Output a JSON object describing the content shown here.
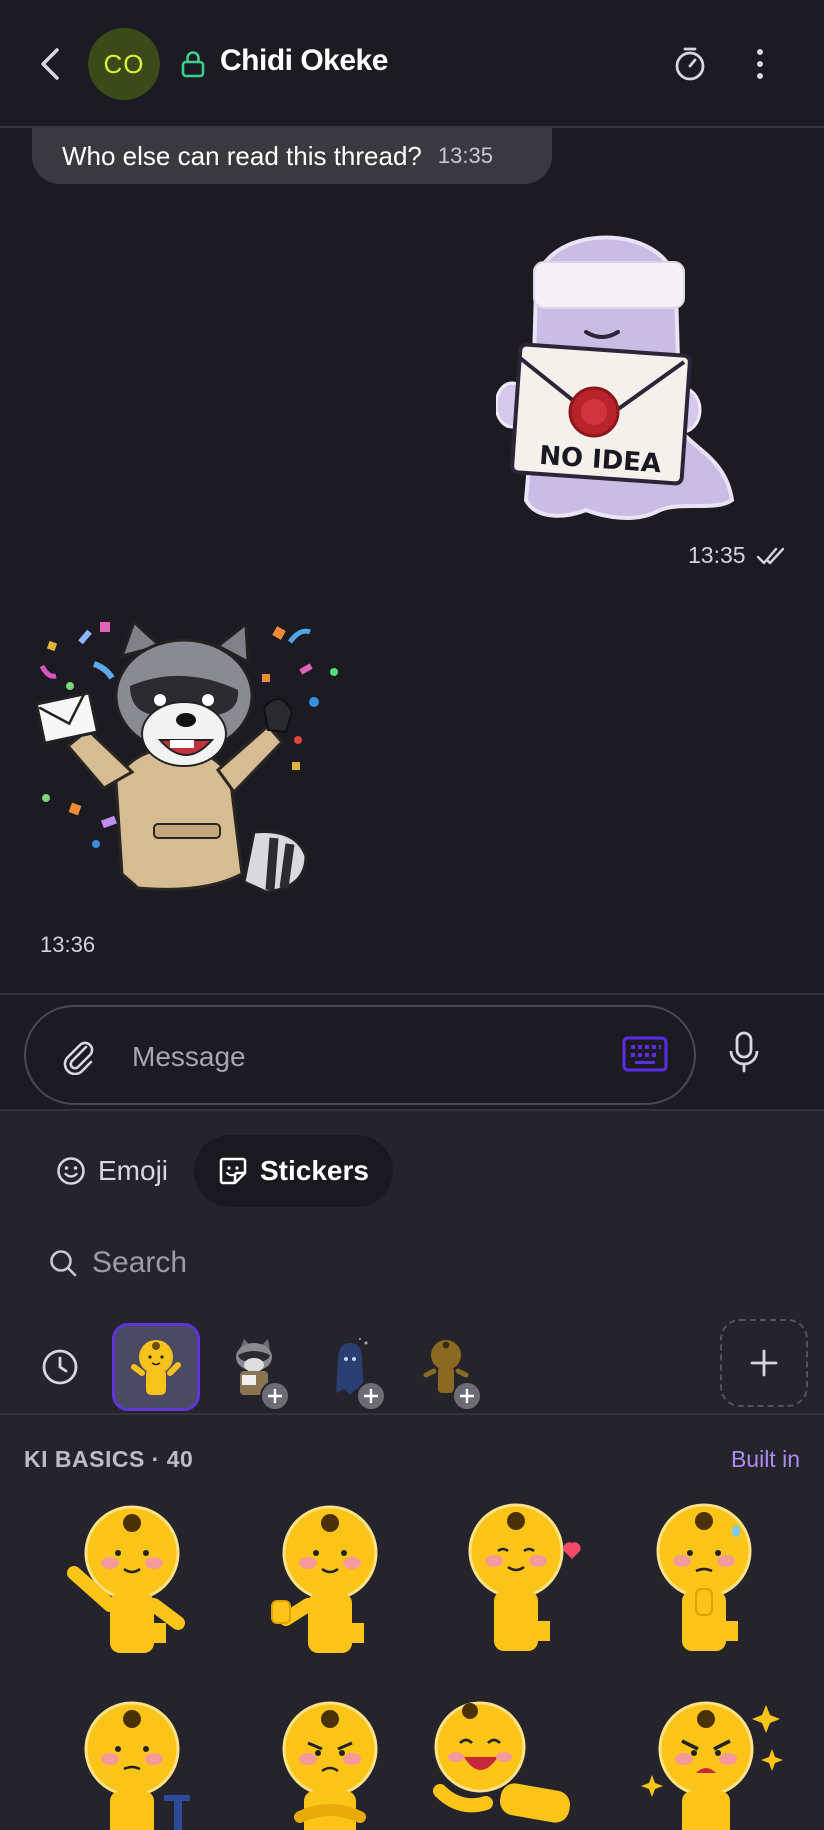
{
  "header": {
    "avatar_initials": "CO",
    "contact_name": "Chidi Okeke",
    "icons": [
      "back-arrow-icon",
      "lock-icon",
      "disappearing-timer-icon",
      "more-vertical-icon"
    ]
  },
  "messages": [
    {
      "direction": "incoming",
      "type": "text",
      "text": "Who else can read this thread?",
      "time": "13:35"
    },
    {
      "direction": "outgoing",
      "type": "sticker",
      "sticker_text": "NO IDEA",
      "time": "13:35",
      "status": "read"
    },
    {
      "direction": "incoming",
      "type": "sticker",
      "time": "13:36"
    }
  ],
  "composer": {
    "placeholder": "Message",
    "icons": [
      "paperclip-icon",
      "keyboard-icon",
      "microphone-icon"
    ]
  },
  "panel": {
    "tabs": [
      {
        "label": "Emoji",
        "selected": false
      },
      {
        "label": "Stickers",
        "selected": true
      }
    ],
    "search_placeholder": "Search",
    "pack_name": "KI BASICS · 40",
    "pack_badge": "Built in"
  },
  "colors": {
    "background": "#1c1b22",
    "panel": "#25242b",
    "accent": "#5d35d9",
    "link": "#ad8cf5",
    "avatar_text": "#d4f23c",
    "lock": "#3ecf8e"
  }
}
